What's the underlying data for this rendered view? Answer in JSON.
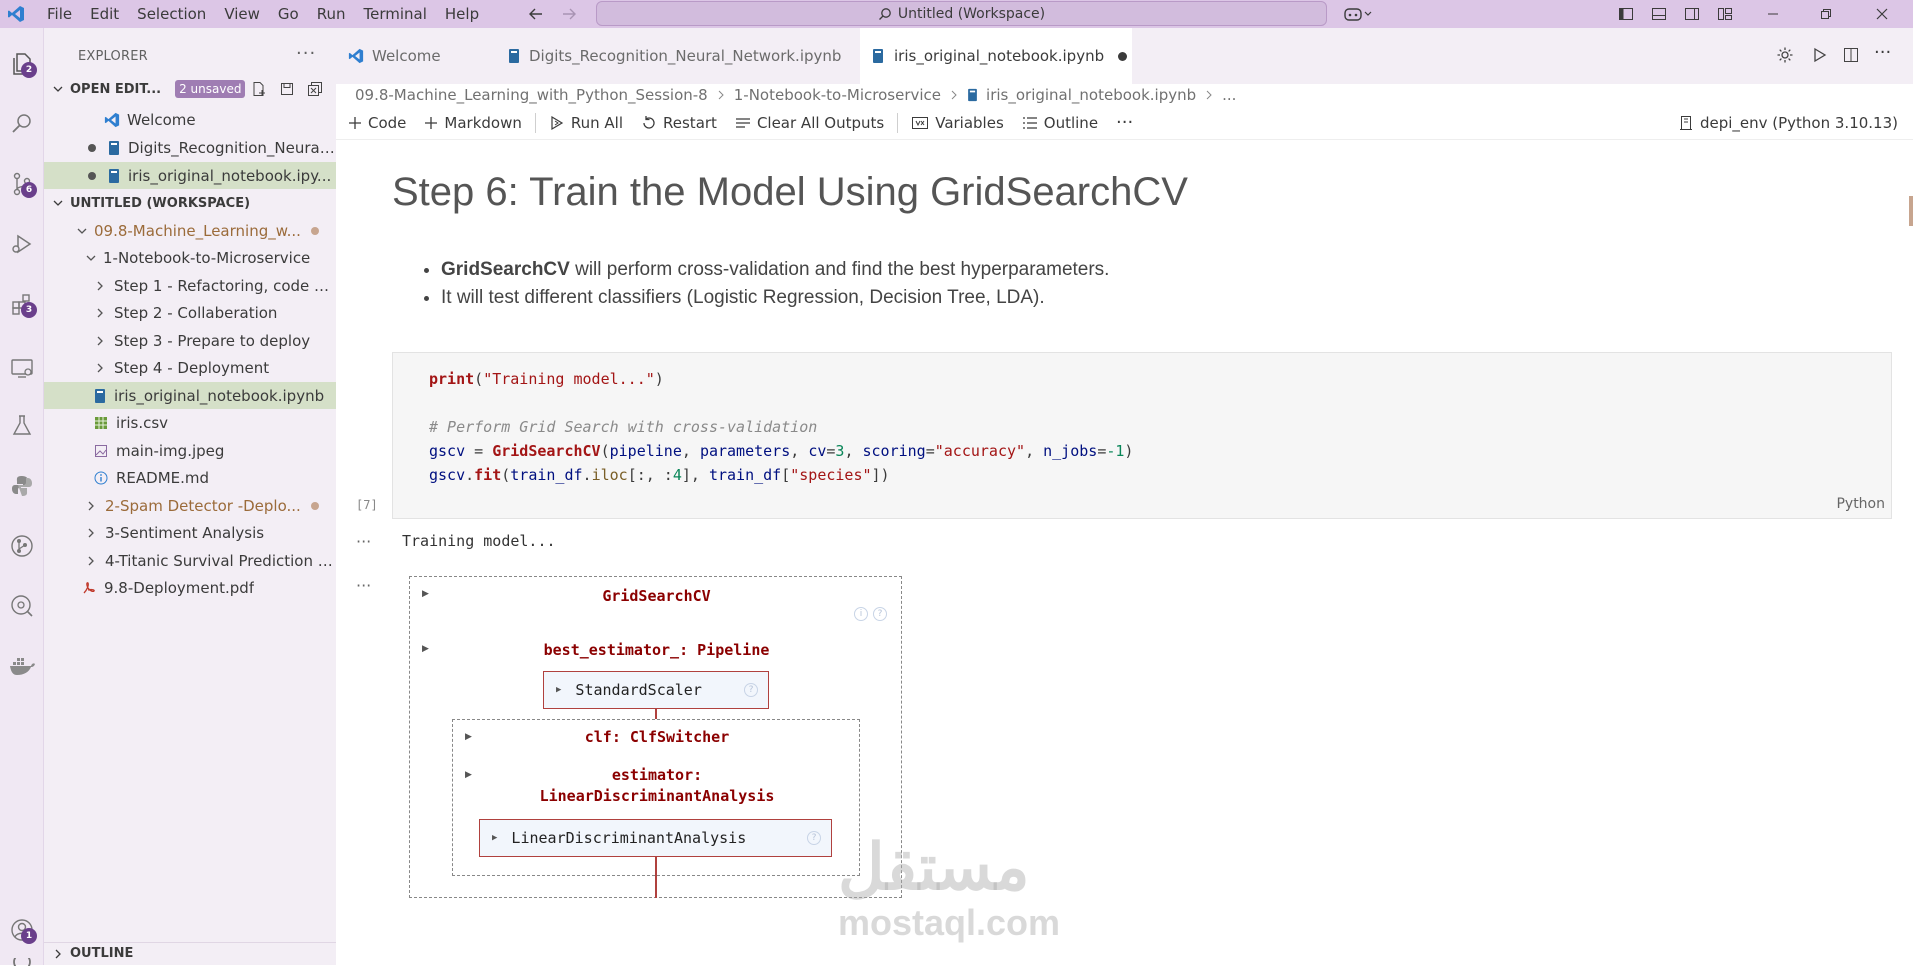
{
  "menu": [
    "File",
    "Edit",
    "Selection",
    "View",
    "Go",
    "Run",
    "Terminal",
    "Help"
  ],
  "command_center": "Untitled (Workspace)",
  "activity_badges": {
    "explorer": "2",
    "source_control": "6",
    "extensions": "3",
    "accounts": "1"
  },
  "sidebar": {
    "title": "EXPLORER",
    "open_editors": {
      "label": "OPEN EDIT...",
      "unsaved": "2 unsaved",
      "items": [
        "Welcome",
        "Digits_Recognition_Neural...",
        "iris_original_notebook.ipy..."
      ]
    },
    "workspace": {
      "label": "UNTITLED (WORKSPACE)",
      "items": [
        "09.8-Machine_Learning_w...",
        "1-Notebook-to-Microservice",
        "Step 1 - Refactoring, code st...",
        "Step 2 - Collaberation",
        "Step 3 - Prepare to deploy",
        "Step 4 - Deployment",
        "iris_original_notebook.ipynb",
        "iris.csv",
        "main-img.jpeg",
        "README.md",
        "2-Spam Detector -Deplo...",
        "3-Sentiment Analysis",
        "4-Titanic Survival Prediction Pr...",
        "9.8-Deployment.pdf"
      ]
    },
    "outline": "OUTLINE"
  },
  "tabs": [
    "Welcome",
    "Digits_Recognition_Neural_Network.ipynb",
    "iris_original_notebook.ipynb"
  ],
  "breadcrumb": [
    "09.8-Machine_Learning_with_Python_Session-8",
    "1-Notebook-to-Microservice",
    "iris_original_notebook.ipynb",
    "..."
  ],
  "toolbar": {
    "code": "Code",
    "markdown": "Markdown",
    "run_all": "Run All",
    "restart": "Restart",
    "clear": "Clear All Outputs",
    "variables": "Variables",
    "outline": "Outline",
    "kernel": "depi_env (Python 3.10.13)"
  },
  "notebook": {
    "heading": "Step 6: Train the Model Using GridSearchCV",
    "bullet1_bold": "GridSearchCV",
    "bullet1_rest": " will perform cross-validation and find the best hyperparameters.",
    "bullet2": "It will test different classifiers (Logistic Regression, Decision Tree, LDA).",
    "exec_count": "[7]",
    "language": "Python",
    "output_text": "Training model...",
    "diagram": {
      "top": "GridSearchCV",
      "best": "best_estimator_: Pipeline",
      "scaler": "StandardScaler",
      "clf": "clf: ClfSwitcher",
      "estimator_line1": "estimator:",
      "estimator_line2": "LinearDiscriminantAnalysis",
      "lda": "LinearDiscriminantAnalysis"
    }
  },
  "watermark": {
    "arabic": "مستقل",
    "latin": "mostaql.com"
  }
}
